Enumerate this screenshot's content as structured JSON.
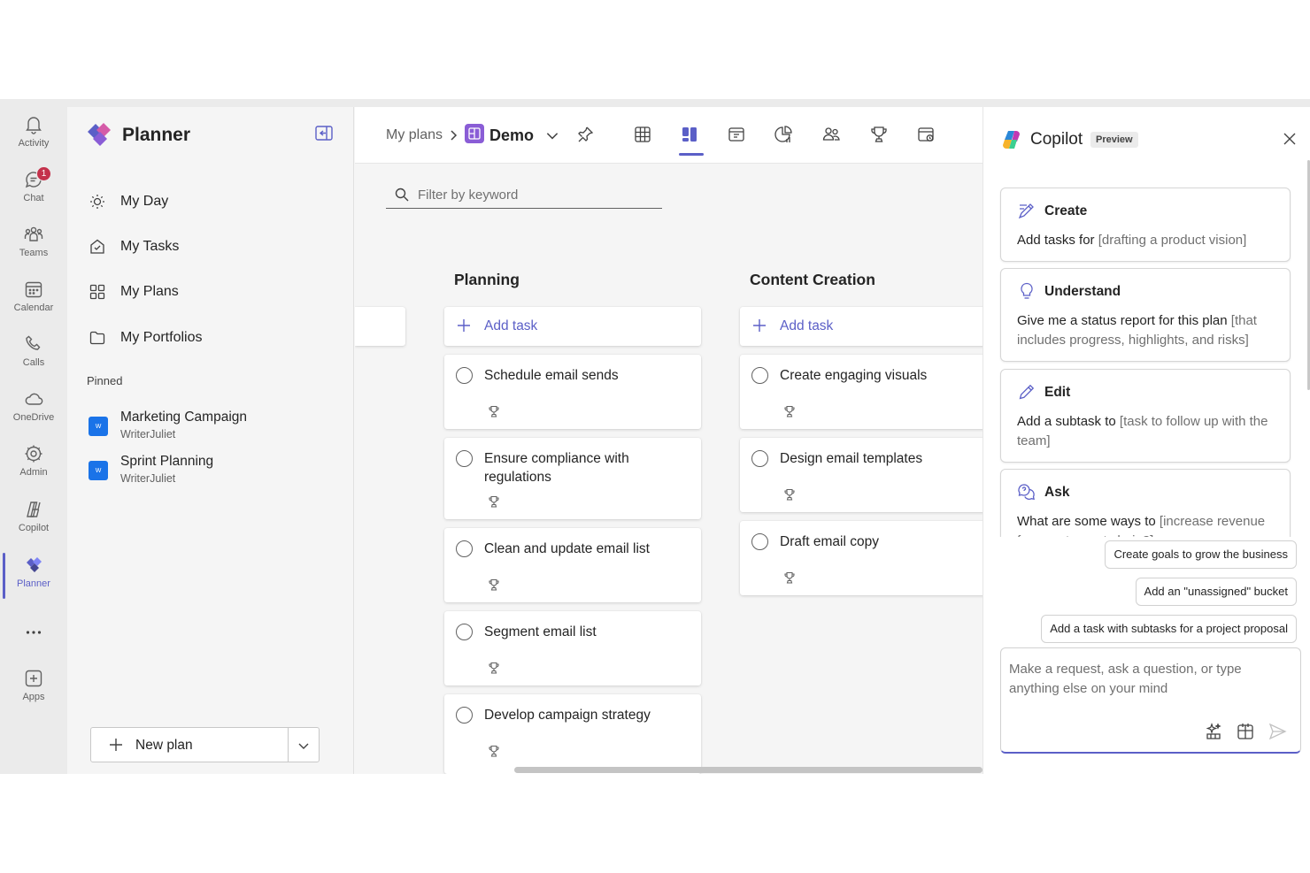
{
  "rail": [
    {
      "label": "Activity",
      "icon": "bell-icon"
    },
    {
      "label": "Chat",
      "icon": "chat-icon",
      "badge": "1"
    },
    {
      "label": "Teams",
      "icon": "teams-icon"
    },
    {
      "label": "Calendar",
      "icon": "calendar-icon"
    },
    {
      "label": "Calls",
      "icon": "phone-icon"
    },
    {
      "label": "OneDrive",
      "icon": "cloud-icon"
    },
    {
      "label": "Admin",
      "icon": "admin-icon"
    },
    {
      "label": "Copilot",
      "icon": "copilot-icon"
    },
    {
      "label": "Planner",
      "icon": "planner-icon",
      "active": true
    },
    {
      "label": "",
      "icon": "more-icon"
    },
    {
      "label": "Apps",
      "icon": "apps-plus-icon"
    }
  ],
  "sidebar": {
    "title": "Planner",
    "nav": [
      {
        "label": "My Day",
        "icon": "sun-icon"
      },
      {
        "label": "My Tasks",
        "icon": "home-check-icon"
      },
      {
        "label": "My Plans",
        "icon": "grid-icon"
      },
      {
        "label": "My Portfolios",
        "icon": "folder-icon"
      }
    ],
    "pinned_label": "Pinned",
    "pinned": [
      {
        "name": "Marketing Campaign",
        "owner": "WriterJuliet",
        "icon_letter": "W"
      },
      {
        "name": "Sprint Planning",
        "owner": "WriterJuliet",
        "icon_letter": "W"
      }
    ],
    "new_plan_label": "New plan"
  },
  "header": {
    "breadcrumb_root": "My plans",
    "plan_name": "Demo",
    "toolbar_icons": [
      "grid-view-icon",
      "board-view-icon",
      "schedule-view-icon",
      "charts-view-icon",
      "people-view-icon",
      "goals-view-icon",
      "timeline-view-icon"
    ],
    "active_view": "board-view-icon"
  },
  "filter": {
    "placeholder": "Filter by keyword"
  },
  "buckets": [
    {
      "title": "Planning",
      "add_label": "Add task",
      "tasks": [
        "Schedule email sends",
        "Ensure compliance with regulations",
        "Clean and update email list",
        "Segment email list",
        "Develop campaign strategy"
      ]
    },
    {
      "title": "Content Creation",
      "add_label": "Add task",
      "tasks": [
        "Create engaging visuals",
        "Design email templates",
        "Draft email copy"
      ]
    }
  ],
  "copilot": {
    "title": "Copilot",
    "badge": "Preview",
    "cards": [
      {
        "heading": "Create",
        "icon": "create-icon",
        "text": "Add tasks for ",
        "hint": "[drafting a product vision]",
        "tail": ""
      },
      {
        "heading": "Understand",
        "icon": "lightbulb-icon",
        "text": "Give me a status report for this plan ",
        "hint": "[that includes progress, highlights, and risks]",
        "tail": ""
      },
      {
        "heading": "Edit",
        "icon": "pencil-icon",
        "text": "Add a subtask to ",
        "hint": "[task to follow up with the team]",
        "tail": ""
      },
      {
        "heading": "Ask",
        "icon": "ask-icon",
        "text": "What are some ways to ",
        "hint": "[increase revenue for a restaurant chain?]",
        "tail": ""
      }
    ],
    "suggestions": [
      "Create goals to grow the business",
      "Add an \"unassigned\" bucket",
      "Add a task with subtasks for a project proposal"
    ],
    "compose_placeholder": "Make a request, ask a question, or type anything else on your mind"
  },
  "colors": {
    "accent": "#5b5fc7",
    "badge": "#c4314b",
    "pinned_icon": "#1a73e8"
  }
}
